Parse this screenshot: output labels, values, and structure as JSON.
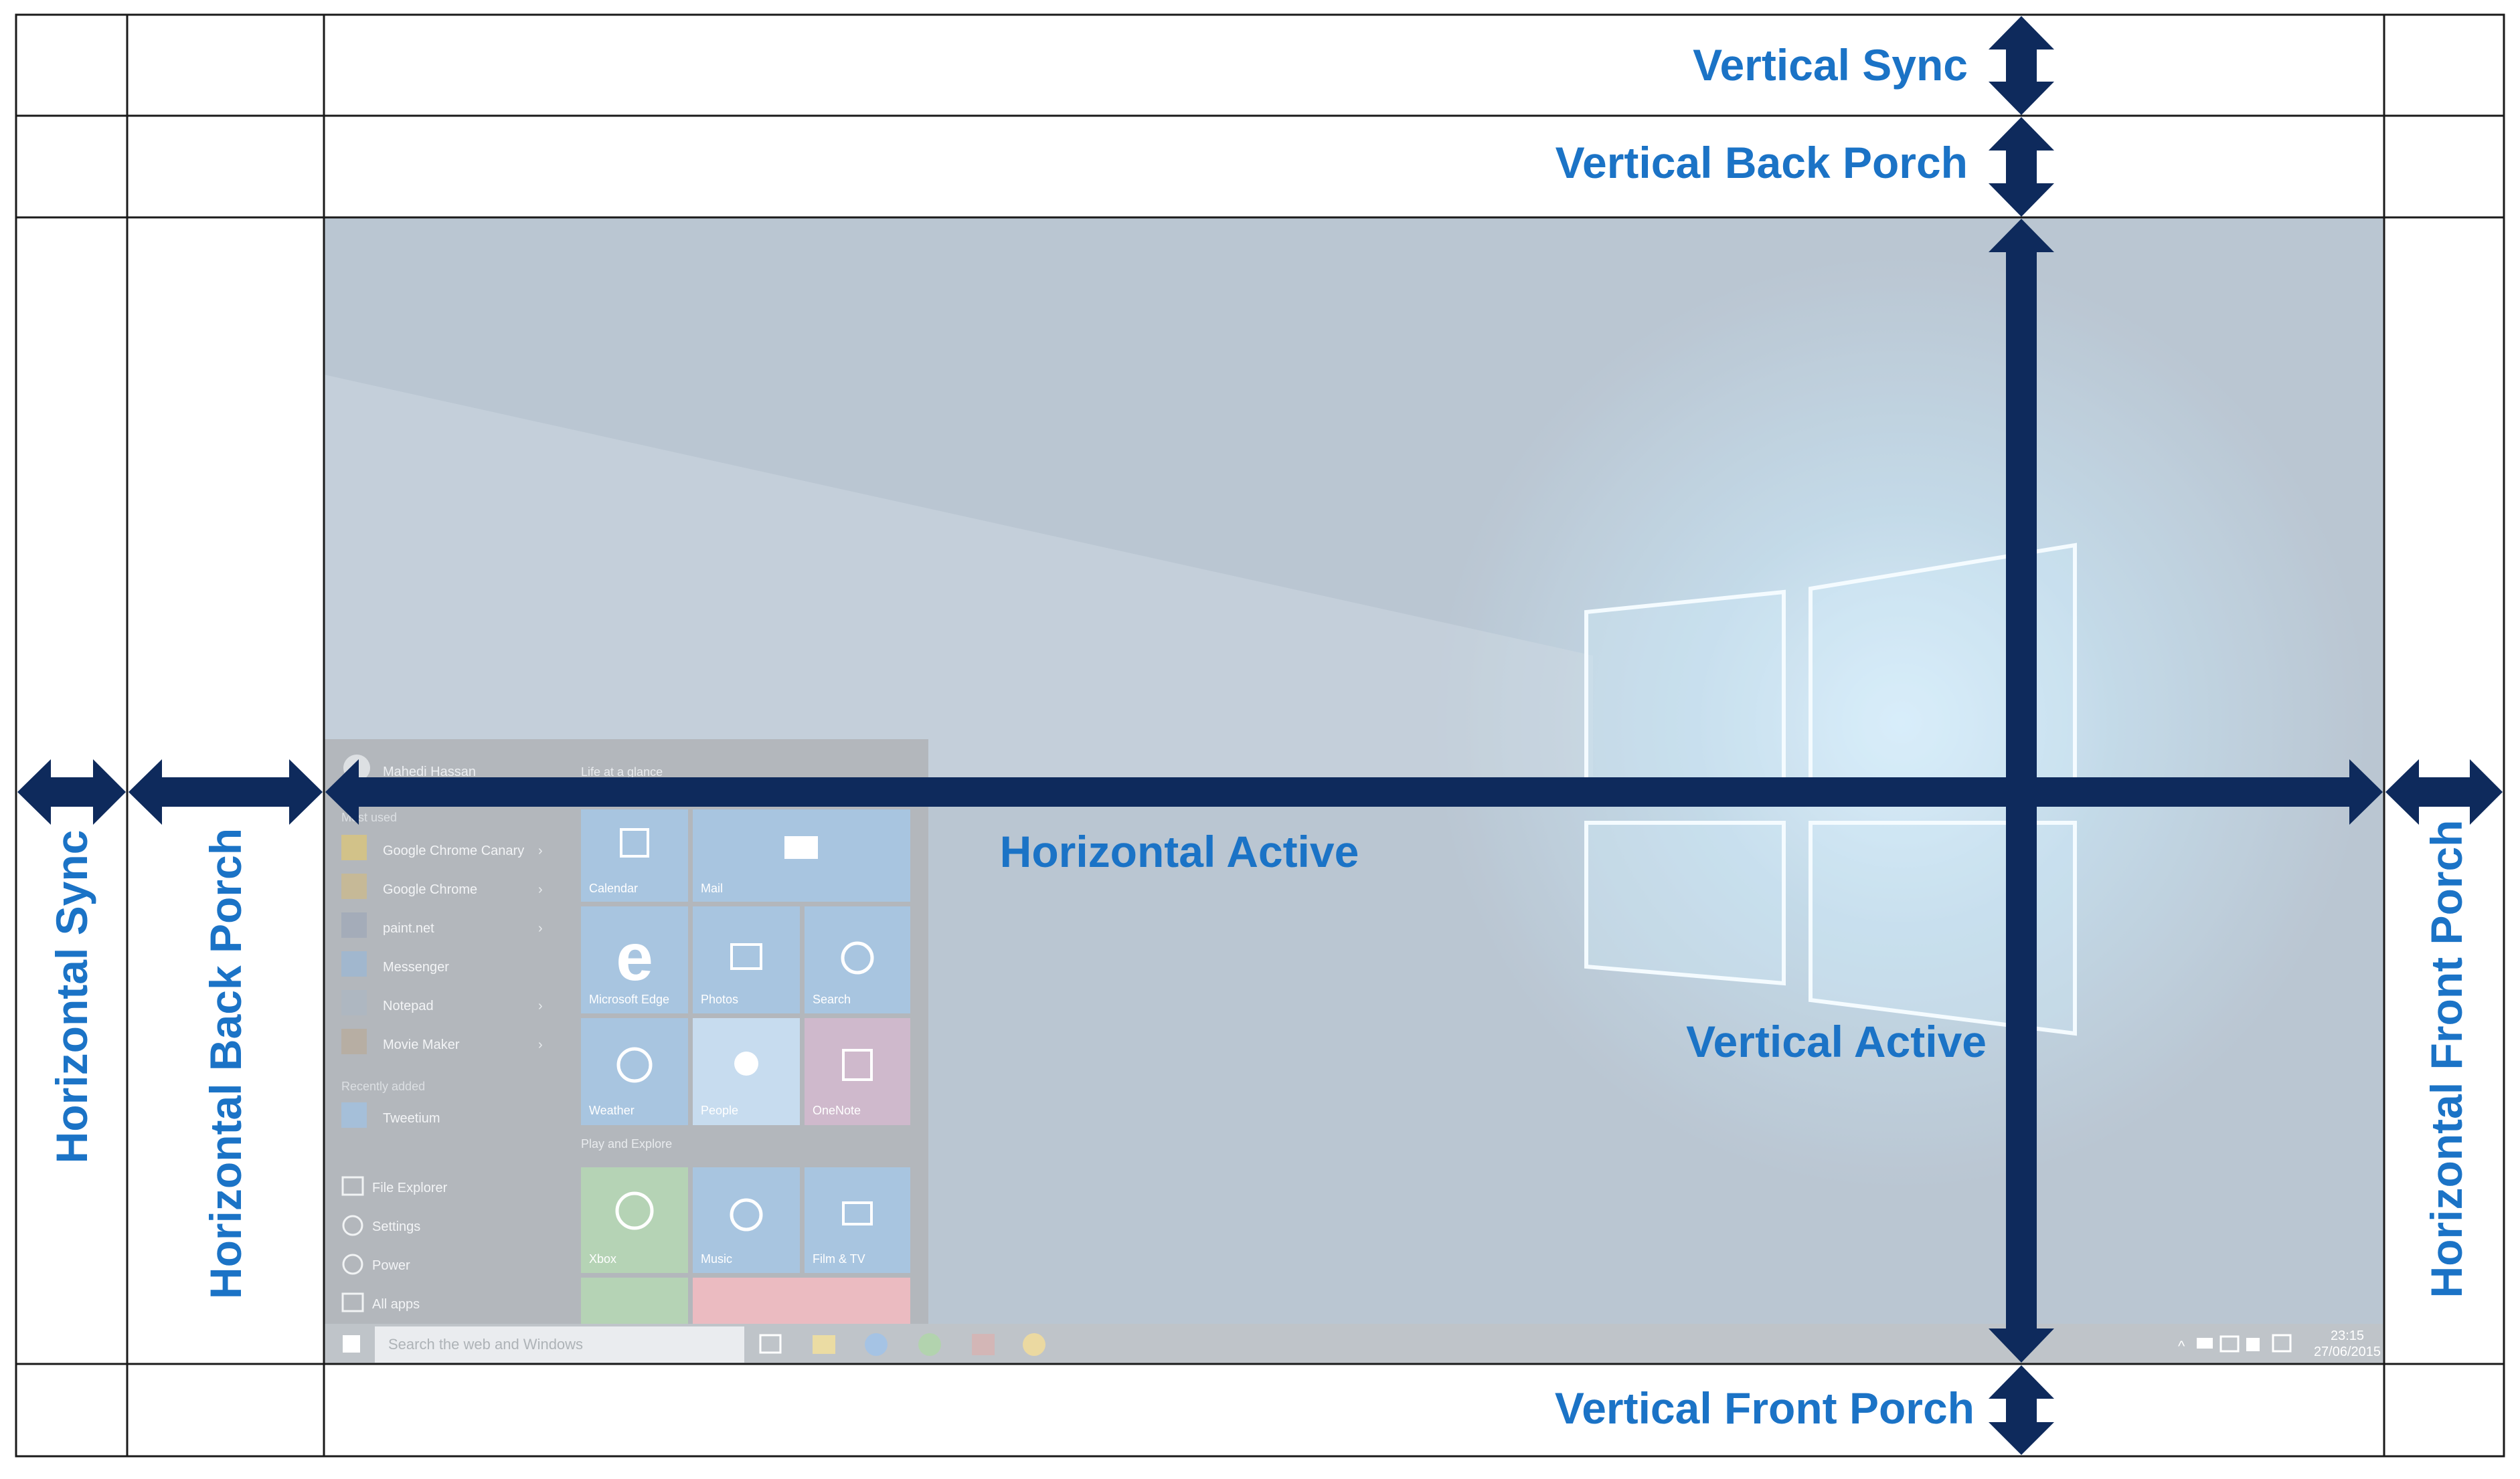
{
  "labels": {
    "vertical_sync": "Vertical Sync",
    "vertical_back_porch": "Vertical Back Porch",
    "vertical_active": "Vertical Active",
    "vertical_front_porch": "Vertical Front Porch",
    "horizontal_sync": "Horizontal Sync",
    "horizontal_back_porch": "Horizontal Back Porch",
    "horizontal_active": "Horizontal Active",
    "horizontal_front_porch": "Horizontal Front Porch"
  },
  "start_menu": {
    "user_name": "Mahedi Hassan",
    "most_used_heading": "Most used",
    "most_used": [
      "Google Chrome Canary",
      "Google Chrome",
      "paint.net",
      "Messenger",
      "Notepad",
      "Movie Maker"
    ],
    "recently_added_heading": "Recently added",
    "recently_added": [
      "Tweetium"
    ],
    "bottom_items": [
      "File Explorer",
      "Settings",
      "Power",
      "All apps"
    ],
    "life_heading": "Life at a glance",
    "life_tiles": [
      "Calendar",
      "Mail",
      "Microsoft Edge",
      "Photos",
      "Search",
      "Weather",
      "People",
      "OneNote"
    ],
    "play_heading": "Play and Explore",
    "play_tiles": [
      "Xbox",
      "Music",
      "Film & TV"
    ]
  },
  "taskbar": {
    "search_placeholder": "Search the web and Windows",
    "time": "23:15",
    "date": "27/06/2015"
  },
  "colors": {
    "arrow": "#0e2a5c",
    "label": "#1b73c6",
    "grid": "#1a1a1a"
  }
}
